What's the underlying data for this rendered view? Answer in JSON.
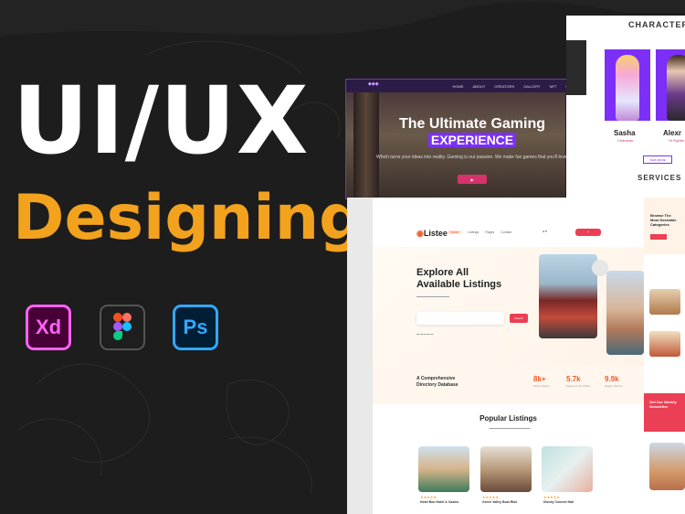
{
  "hero": {
    "title": "UI/UX",
    "subtitle": "Designing"
  },
  "tools": [
    {
      "name": "xd-icon",
      "label": "Xd"
    },
    {
      "name": "figma-icon",
      "label": ""
    },
    {
      "name": "photoshop-icon",
      "label": "Ps"
    }
  ],
  "gaming": {
    "title": "The Ultimate Gaming",
    "highlight": "EXPERIENCE",
    "description": "Which turns your ideas into reality. Gaming is our passion. We make fun games that you'll love.",
    "nav": [
      "HOME",
      "ABOUT",
      "CREATORS",
      "GALLERY",
      "NFT",
      "CONTACT US"
    ]
  },
  "characters": {
    "title": "CHARACTERS",
    "items": [
      {
        "name": "Sasha",
        "role": "Character"
      },
      {
        "name": "Alexr",
        "role": "Hi Fighter"
      }
    ],
    "button": "VIEW MORE",
    "services": "SERVICES"
  },
  "listee": {
    "logo": "Listee",
    "nav": [
      "Home",
      "Listings",
      "Pages",
      "Contact"
    ],
    "heading_line1": "Explore All",
    "heading_line2": "Available Listings",
    "search_button": "Search",
    "stats_heading_line1": "A Comprehensive",
    "stats_heading_line2": "Directory Database",
    "stats": [
      {
        "value": "8k+",
        "label": "Total Listings"
      },
      {
        "value": "5.7k",
        "label": "Places in the World"
      },
      {
        "value": "9.9k",
        "label": "Happy Visitors"
      }
    ],
    "popular_title": "Popular Listings",
    "listings": [
      {
        "title": "Hotel Bon Hotel & Casino",
        "stars": "★★★★★"
      },
      {
        "title": "Green Valley Boat Ride",
        "stars": "★★★★★"
      },
      {
        "title": "Disney Concert Hall",
        "stars": "★★★★★"
      }
    ]
  },
  "side": {
    "browse_line1": "Browse The",
    "browse_line2": "Most Desirable",
    "browse_line3": "Categories",
    "newsletter_line1": "Get Our Weekly",
    "newsletter_line2": "Newsletter"
  }
}
